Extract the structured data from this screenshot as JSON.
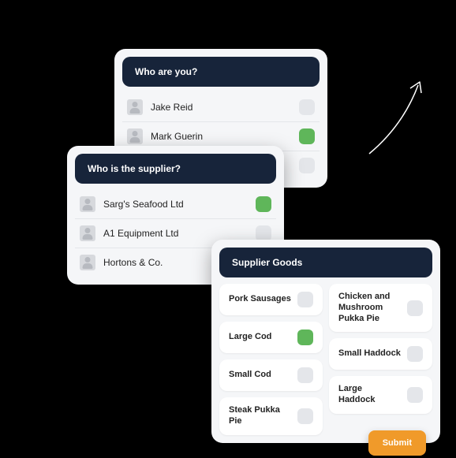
{
  "colors": {
    "accent": "#5fb65a",
    "header": "#17243a",
    "submit": "#f09a2a"
  },
  "card_user": {
    "title": "Who are you?",
    "items": [
      {
        "label": "Jake Reid",
        "checked": false
      },
      {
        "label": "Mark Guerin",
        "checked": true
      },
      {
        "label": "",
        "checked": false
      }
    ]
  },
  "card_supplier": {
    "title": "Who is the supplier?",
    "items": [
      {
        "label": "Sarg's Seafood Ltd",
        "checked": true
      },
      {
        "label": "A1 Equipment Ltd",
        "checked": false
      },
      {
        "label": "Hortons & Co.",
        "checked": false
      }
    ]
  },
  "card_goods": {
    "title": "Supplier Goods",
    "left": [
      {
        "label": "Pork Sausages",
        "checked": false
      },
      {
        "label": "Large Cod",
        "checked": true
      },
      {
        "label": "Small Cod",
        "checked": false
      },
      {
        "label": "Steak Pukka Pie",
        "checked": false
      }
    ],
    "right": [
      {
        "label": "Chicken and Mushroom Pukka Pie",
        "checked": false
      },
      {
        "label": "Small Haddock",
        "checked": false
      },
      {
        "label": "Large Haddock",
        "checked": false
      }
    ],
    "submit_label": "Submit"
  }
}
